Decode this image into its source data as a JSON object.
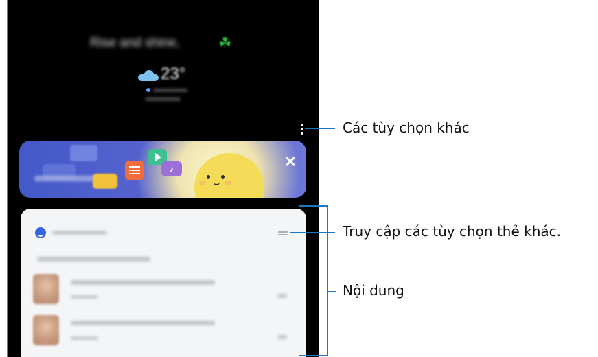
{
  "screen": {
    "greeting": "Rise and shine,",
    "greeting_emoji": "☘",
    "temperature": "23°",
    "music_glyph": "♪",
    "close_glyph": "✕"
  },
  "callouts": {
    "more_options": "Các tùy chọn khác",
    "card_options": "Truy cập các tùy chọn thẻ khác.",
    "content": "Nội dung"
  },
  "colors": {
    "callout_line": "#1b77c2",
    "banner_start": "#4458c8",
    "banner_end": "#6d77d8",
    "mascot": "#f4dc58",
    "card_background": "#f4f5f7",
    "screen_background": "#000000"
  }
}
